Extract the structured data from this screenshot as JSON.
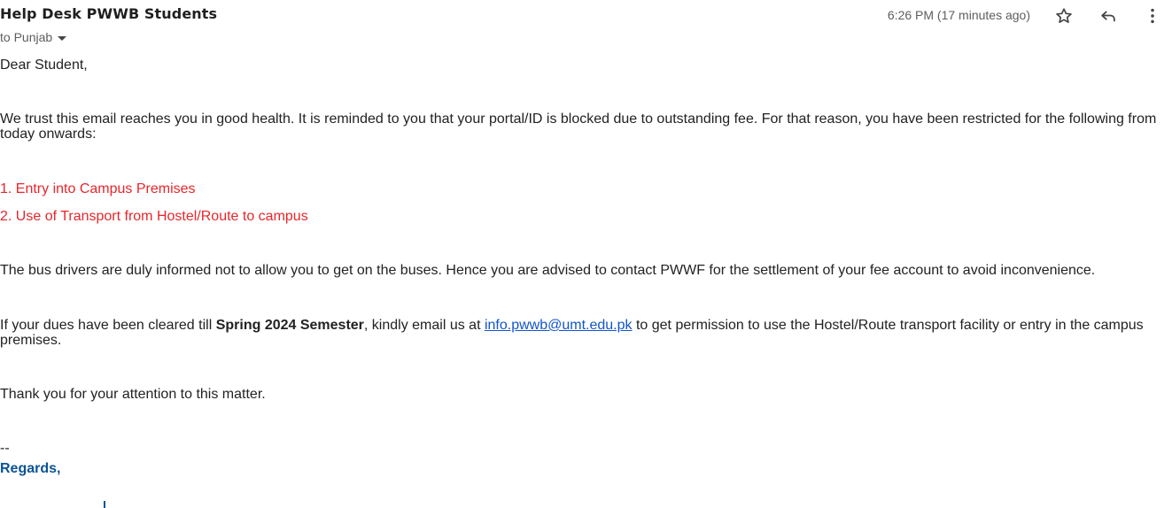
{
  "header": {
    "sender": "Help Desk PWWB Students",
    "to": "to Punjab",
    "time": "6:26 PM (17 minutes ago)",
    "icons": {
      "star": "star-icon",
      "reply": "reply-icon",
      "more": "more-vertical-icon"
    }
  },
  "email": {
    "greeting": "Dear Student,",
    "para1": "We trust this email reaches you in good health. It is reminded to you that your portal/ID is blocked due to outstanding fee. For that reason, you have been restricted for the following from today onwards:",
    "restrictions": [
      "1. Entry into Campus Premises",
      "2. Use of Transport from Hostel/Route to campus"
    ],
    "para2": "The bus drivers are duly informed not to allow you to get on the buses. Hence you are advised to contact PWWF for the settlement of your fee account to avoid inconvenience.",
    "para3_prefix": "If your dues have been cleared till ",
    "para3_bold": "Spring 2024 Semester",
    "para3_mid": ", kindly email us at ",
    "para3_link": "info.pwwb@umt.edu.pk",
    "para3_suffix": " to get permission to use the Hostel/Route transport facility or entry in the campus premises.",
    "para4": "Thank you for your attention to this matter.",
    "signature_dash": "--",
    "regards": "Regards,"
  },
  "colors": {
    "restriction_red": "#e8262b",
    "regards_blue": "#0b5394",
    "link_blue": "#1155cc"
  }
}
